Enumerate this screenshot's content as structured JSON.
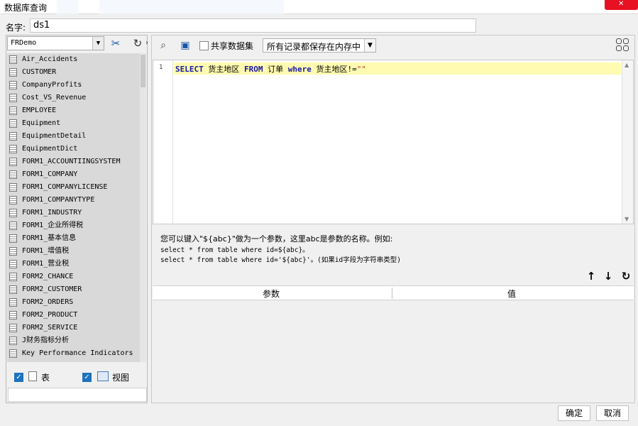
{
  "window": {
    "title": "数据库查询"
  },
  "name_field": {
    "label": "名字:",
    "value": "ds1"
  },
  "datasource": {
    "selected": "FRDemo"
  },
  "tables": [
    "Air_Accidents",
    "CUSTOMER",
    "CompanyProfits",
    "Cost_VS_Revenue",
    "EMPLOYEE",
    "Equipment",
    "EquipmentDetail",
    "EquipmentDict",
    "FORM1_ACCOUNTIINGSYSTEM",
    "FORM1_COMPANY",
    "FORM1_COMPANYLICENSE",
    "FORM1_COMPANYTYPE",
    "FORM1_INDUSTRY",
    "FORM1_企业所得税",
    "FORM1_基本信息",
    "FORM1_增值税",
    "FORM1_营业税",
    "FORM2_CHANCE",
    "FORM2_CUSTOMER",
    "FORM2_ORDERS",
    "FORM2_PRODUCT",
    "FORM2_SERVICE",
    "J财务指标分析",
    "Key Performance Indicators"
  ],
  "filters": {
    "table_label": "表",
    "view_label": "视图"
  },
  "toolbar": {
    "share_label": "共享数据集",
    "memory_option": "所有记录都保存在内存中"
  },
  "editor": {
    "line_number": "1",
    "tokens": [
      {
        "text": "SELECT",
        "cls": "kw"
      },
      {
        "text": " 货主地区 ",
        "cls": ""
      },
      {
        "text": "FROM",
        "cls": "kw"
      },
      {
        "text": " 订单 ",
        "cls": ""
      },
      {
        "text": "where",
        "cls": "kw"
      },
      {
        "text": " 货主地区!=",
        "cls": ""
      },
      {
        "text": "\"\"",
        "cls": "str"
      }
    ]
  },
  "hints": [
    "您可以键入\"${abc}\"做为一个参数，这里abc是参数的名称。例如:",
    "select * from table where id=${abc}。",
    "select * from table where id='${abc}'。(如果id字段为字符串类型)"
  ],
  "param_table": {
    "col_param": "参数",
    "col_value": "值"
  },
  "buttons": {
    "ok": "确定",
    "cancel": "取消"
  }
}
